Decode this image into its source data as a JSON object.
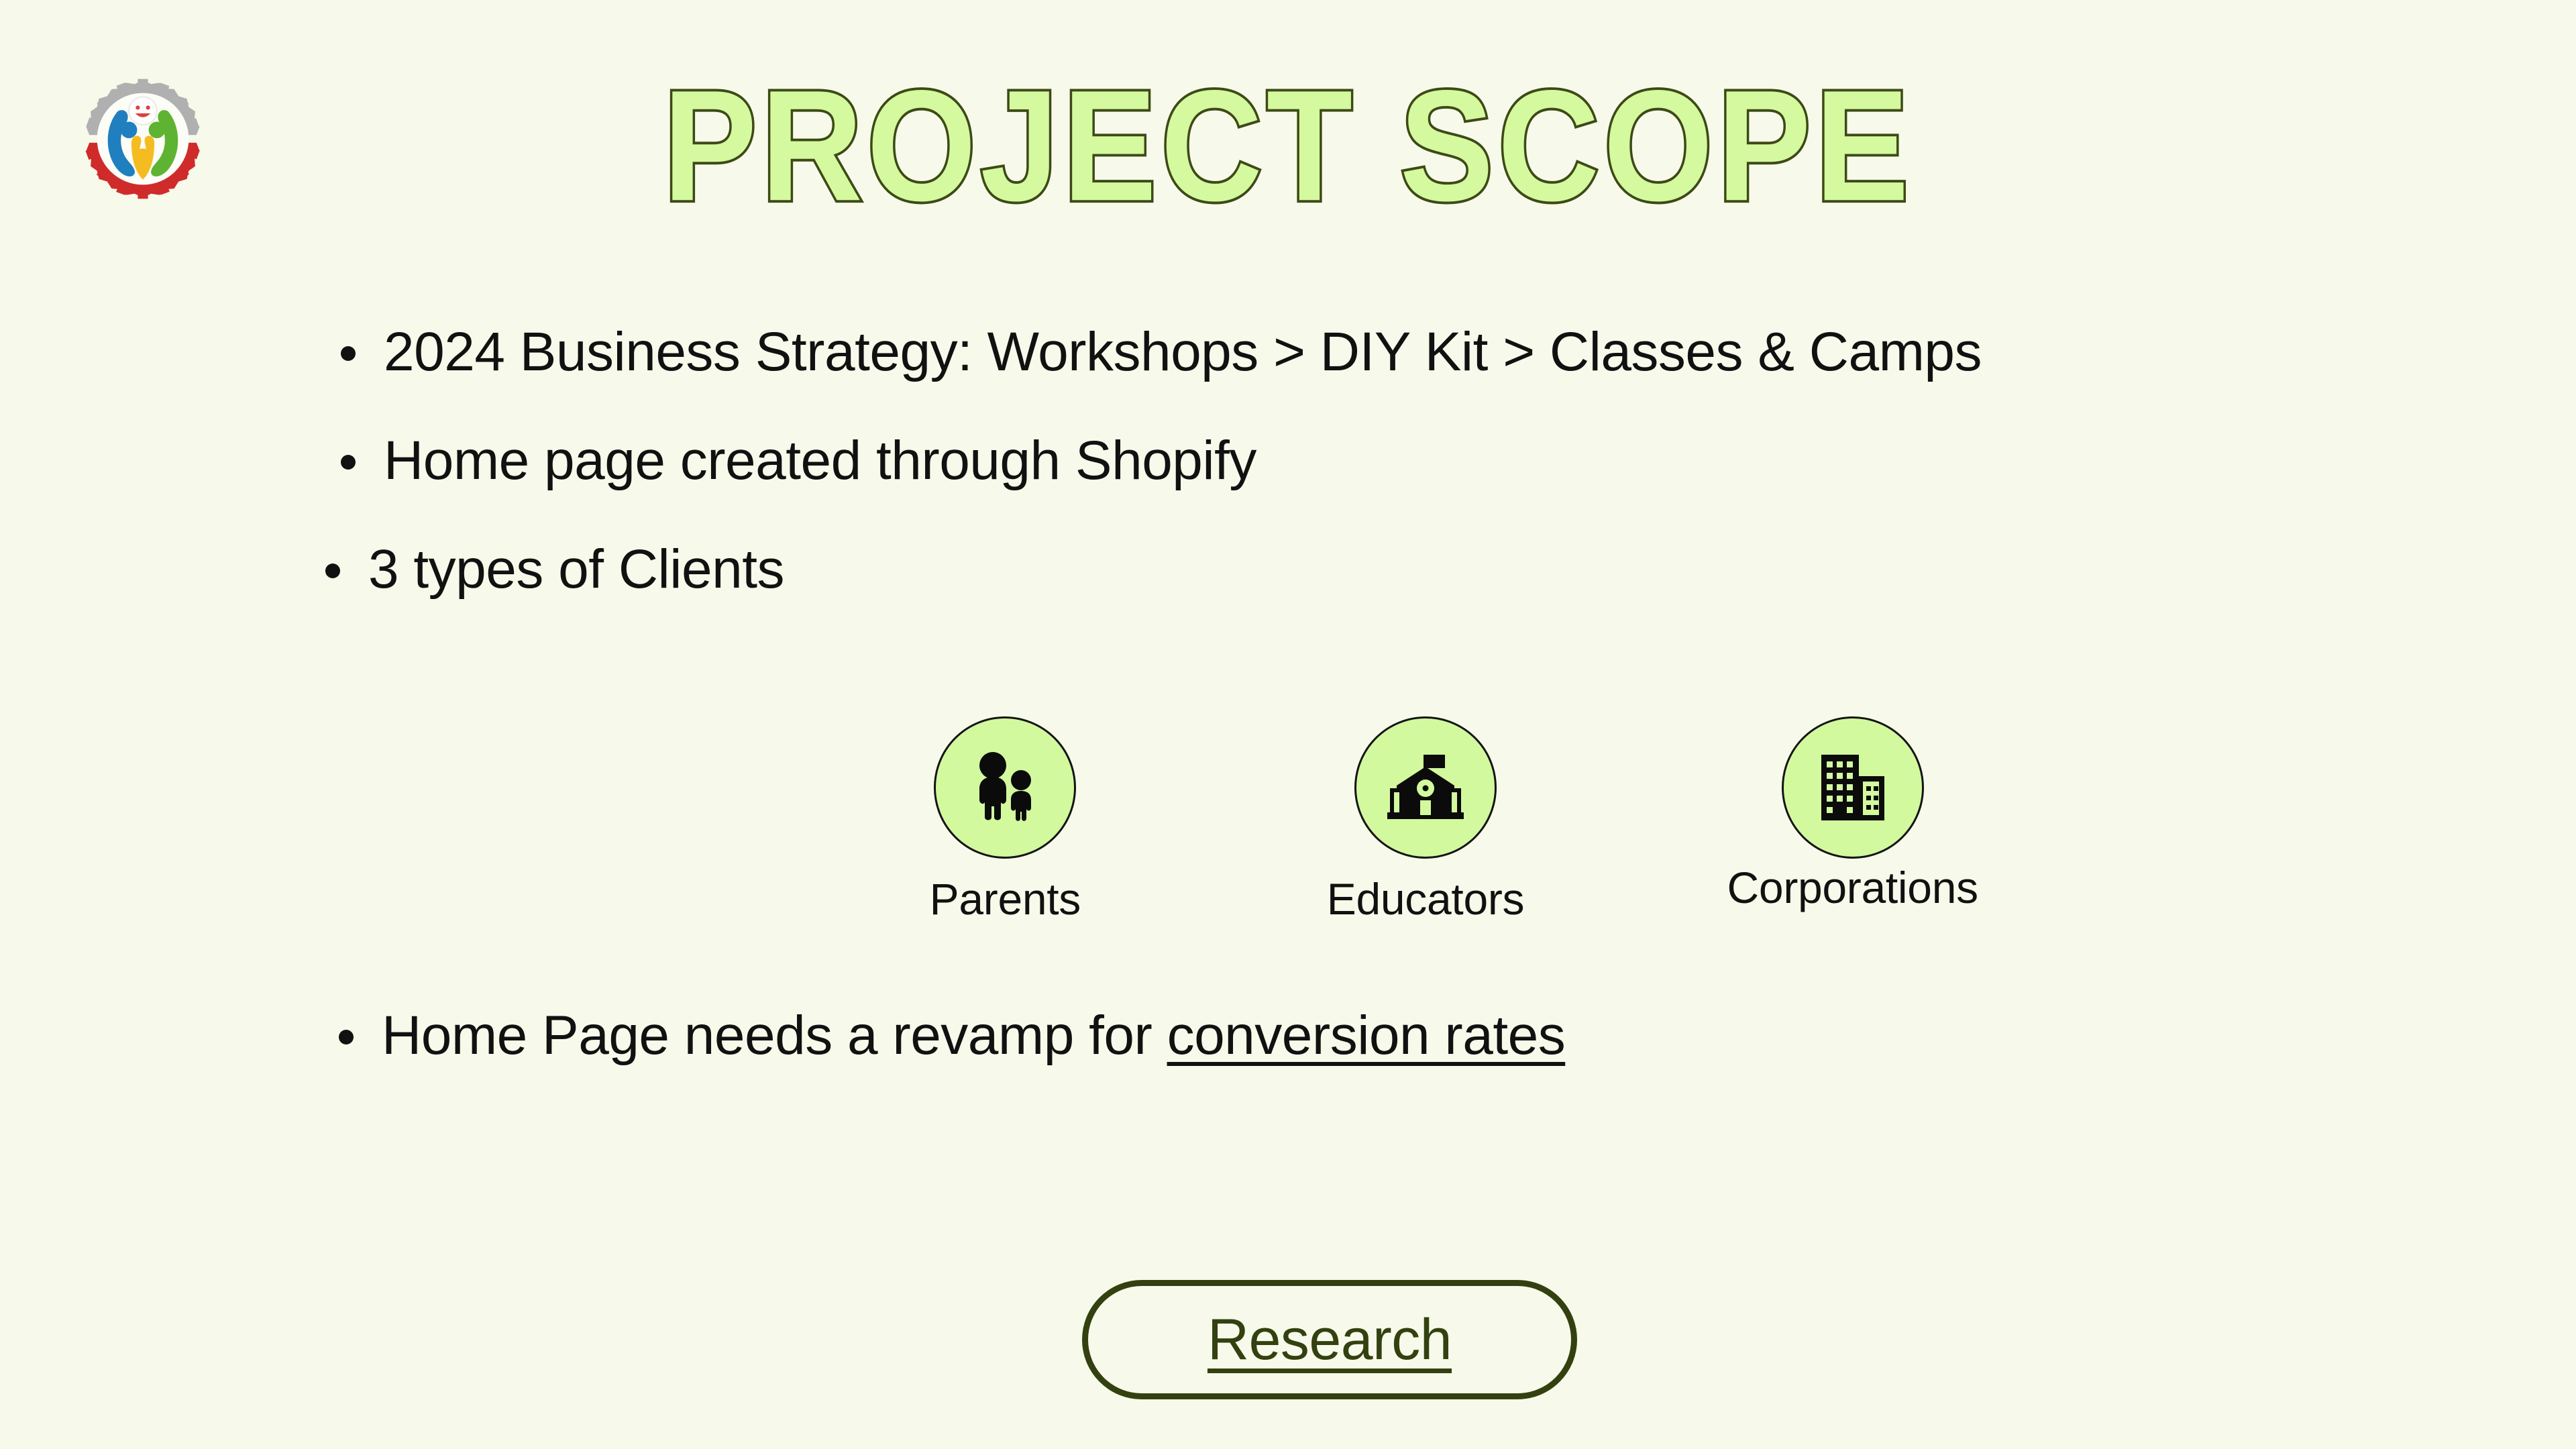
{
  "slide": {
    "background_color": "#f7f9ea",
    "title": "PROJECT SCOPE",
    "title_fill_color": "#d4f99f",
    "title_outline_color": "#3d4a16"
  },
  "logo": {
    "name": "company-gear-people-logo",
    "gear_top_color": "#b0b0b0",
    "gear_bottom_color": "#cf2b2b",
    "figure_left_color": "#1f7fbf",
    "figure_center_color": "#f5bc22",
    "figure_right_color": "#5fb333",
    "face_color": "#ffffff"
  },
  "bullets_top": [
    {
      "text": "2024 Business Strategy: Workshops > DIY Kit > Classes & Camps"
    },
    {
      "text": "Home page created through Shopify"
    },
    {
      "text": "3 types of Clients"
    }
  ],
  "clients": {
    "circle_fill": "#d2f99e",
    "circle_border": "#141414",
    "items": [
      {
        "label": "Parents",
        "icon": "parent-and-child-icon"
      },
      {
        "label": "Educators",
        "icon": "school-building-icon"
      },
      {
        "label": "Corporations",
        "icon": "office-buildings-icon"
      }
    ]
  },
  "bullet_bottom": {
    "prefix": "Home Page needs a revamp for ",
    "link_text": "conversion rates"
  },
  "research_button": {
    "label": "Research",
    "border_color": "#32410f",
    "text_color": "#32410f"
  }
}
